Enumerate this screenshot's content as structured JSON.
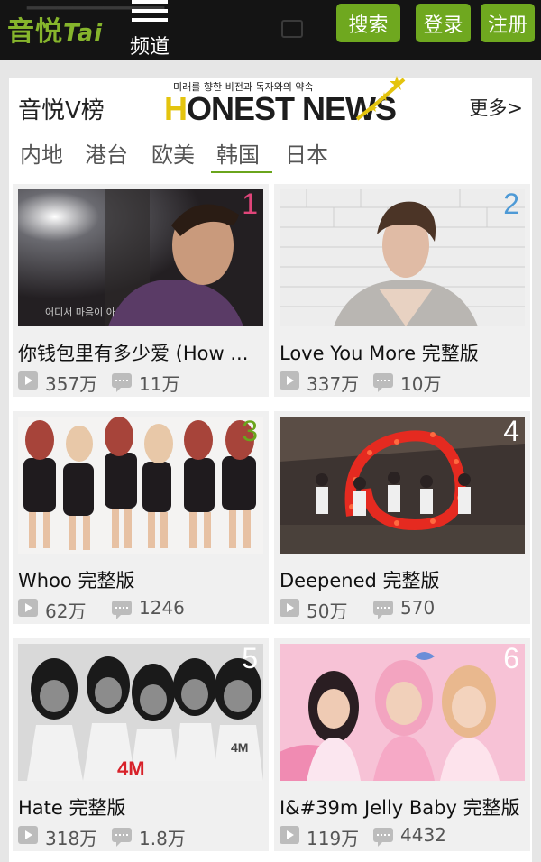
{
  "header": {
    "logo": "音悦",
    "logo_suffix": "Tai",
    "menu_label": "频道",
    "search_label": "搜索",
    "login_label": "登录",
    "register_label": "注册",
    "accent_color": "#6fa81f"
  },
  "panel": {
    "title": "音悦V榜",
    "more_label": "更多>",
    "banner_small": "미래를 향한 비전과 독자와의 약속",
    "banner_h": "H",
    "banner_rest": "ONEST NEWS",
    "tabs": [
      "内地",
      "港台",
      "欧美",
      "韩国",
      "日本"
    ],
    "active_tab": "韩国"
  },
  "videos": [
    {
      "rank": "1",
      "rank_color": "#e0457a",
      "title": "你钱包里有多少爱 (How ...",
      "plays": "357万",
      "comments": "11万",
      "thumb_icon": "man-portrait-thumbnail"
    },
    {
      "rank": "2",
      "rank_color": "#4e9ad6",
      "title": "Love You More 完整版",
      "plays": "337万",
      "comments": "10万",
      "thumb_icon": "singer-thumbnail"
    },
    {
      "rank": "3",
      "rank_color": "#6aa51c",
      "title": "Whoo 完整版",
      "plays": "62万",
      "comments": "1246",
      "thumb_icon": "girl-group-thumbnail"
    },
    {
      "rank": "4",
      "rank_color": "#ffffff",
      "title": "Deepened 完整版",
      "plays": "50万",
      "comments": "570",
      "thumb_icon": "stage-lights-thumbnail"
    },
    {
      "rank": "5",
      "rank_color": "#ffffff",
      "title": "Hate 完整版",
      "plays": "318万",
      "comments": "1.8万",
      "thumb_icon": "4minute-thumbnail"
    },
    {
      "rank": "6",
      "rank_color": "#ffffff",
      "title": "I&#39m Jelly Baby 完整版",
      "plays": "119万",
      "comments": "4432",
      "thumb_icon": "pink-girl-group-thumbnail"
    }
  ]
}
